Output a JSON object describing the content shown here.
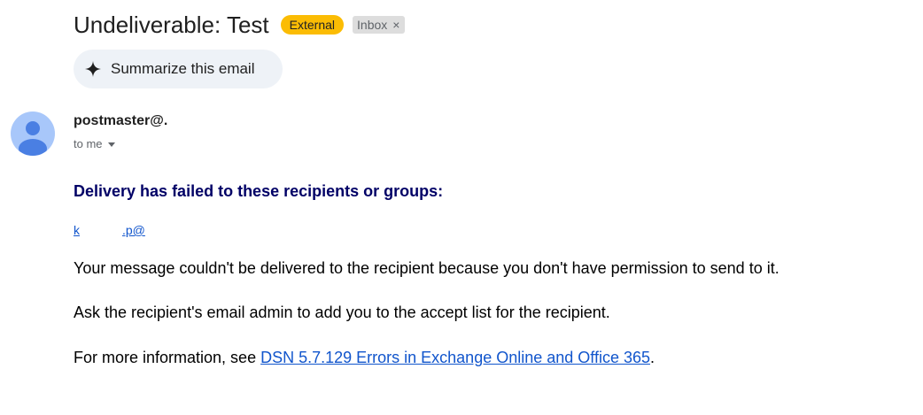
{
  "email": {
    "subject": "Undeliverable: Test",
    "labels": {
      "external": "External",
      "inbox": "Inbox",
      "inbox_remove": "×"
    },
    "summarize_label": "Summarize this email",
    "sender": "postmaster@.",
    "to_label": "to me",
    "body": {
      "heading": "Delivery has failed to these recipients or groups:",
      "recipient_part1": "k",
      "recipient_part2": ".p@",
      "para1": "Your message couldn't be delivered to the recipient because you don't have permission to send to it.",
      "para2": "Ask the recipient's email admin to add you to the accept list for the recipient.",
      "para3_prefix": "For more information, see ",
      "para3_link": "DSN 5.7.129 Errors in Exchange Online and Office 365",
      "para3_suffix": "."
    }
  },
  "colors": {
    "external_label": "#fbbc04",
    "inbox_label": "#dddddd",
    "heading": "#000066",
    "link": "#1155cc",
    "avatar_bg": "#a8c7fa",
    "avatar_fg": "#4a7fe3",
    "summarize_bg": "#eef2f7"
  },
  "icons": {
    "summarize": "sparkle-icon",
    "avatar": "person-avatar-icon",
    "to_dropdown": "caret-down-icon",
    "label_remove": "close-icon"
  }
}
